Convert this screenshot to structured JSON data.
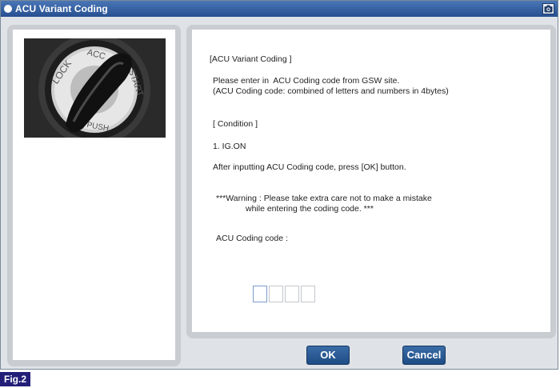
{
  "window": {
    "title": "ACU Variant Coding",
    "camera_icon": "camera-icon"
  },
  "content": {
    "heading": "[ACU Variant Coding ]",
    "instruction_line1": "Please enter in  ACU Coding code from GSW site.",
    "instruction_line2": "(ACU Coding code: combined of letters and numbers in 4bytes)",
    "condition_heading": "[ Condition ]",
    "condition_item": "1. IG.ON",
    "after_input_note": "After inputting ACU Coding code, press [OK] button.",
    "warning_line1": "***Warning : Please take extra care not to make a mistake",
    "warning_line2": "while entering the coding code. ***",
    "code_label": "ACU Coding code :",
    "code_values": [
      "",
      "",
      "",
      ""
    ]
  },
  "buttons": {
    "ok": "OK",
    "cancel": "Cancel"
  },
  "figure_label": "Fig.2",
  "photo_text": {
    "lock": "LOCK",
    "acc": "ACC",
    "start": "START",
    "push": "PUSH"
  },
  "colors": {
    "title_bar": "#2f5b9c",
    "button": "#2a5c96",
    "fig_label": "#231f78"
  }
}
